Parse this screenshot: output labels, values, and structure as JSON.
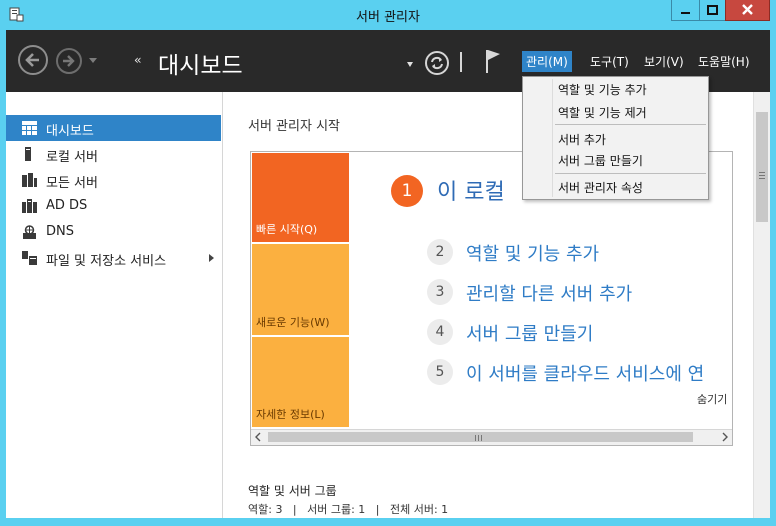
{
  "window": {
    "title": "서버 관리자",
    "close_color": "#c7483f",
    "accent_color": "#5ad0f0"
  },
  "toolbar": {
    "breadcrumb_arrows": "‹‹",
    "page_title": "대시보드",
    "icons": [
      "back-arrow-icon",
      "forward-arrow-icon",
      "refresh-icon",
      "flag-icon"
    ],
    "menus": [
      {
        "label": "관리(M)",
        "active": true
      },
      {
        "label": "도구(T)"
      },
      {
        "label": "보기(V)"
      },
      {
        "label": "도움말(H)"
      }
    ]
  },
  "manage_menu": {
    "items": [
      "역할 및 기능 추가",
      "역할 및 기능 제거",
      "서버 추가",
      "서버 그룹 만들기",
      "서버 관리자 속성"
    ]
  },
  "sidebar": {
    "items": [
      {
        "label": "대시보드",
        "icon": "dashboard-icon",
        "selected": true
      },
      {
        "label": "로컬 서버",
        "icon": "server-icon"
      },
      {
        "label": "모든 서버",
        "icon": "servers-icon"
      },
      {
        "label": "AD DS",
        "icon": "ad-ds-icon"
      },
      {
        "label": "DNS",
        "icon": "dns-icon"
      },
      {
        "label": "파일 및 저장소 서비스",
        "icon": "file-storage-icon",
        "has_submenu": true
      }
    ]
  },
  "main": {
    "section_title": "서버 관리자 시작",
    "tiles": [
      {
        "label": "빠른 시작(Q)",
        "color": "#f26522"
      },
      {
        "label": "새로운 기능(W)",
        "color": "#fbb040"
      },
      {
        "label": "자세한 정보(L)",
        "color": "#fbb040"
      }
    ],
    "big_step": {
      "number": "1",
      "label": "이 로컬"
    },
    "steps": [
      {
        "number": "2",
        "label": "역할 및 기능 추가"
      },
      {
        "number": "3",
        "label": "관리할 다른 서버 추가"
      },
      {
        "number": "4",
        "label": "서버 그룹 만들기"
      },
      {
        "number": "5",
        "label": "이 서버를 클라우드 서비스에 연"
      }
    ],
    "hide_link": "숨기기",
    "roles_title": "역할 및 서버 그룹",
    "roles_summary": "역할: 3   |   서버 그룹: 1   |   전체 서버: 1"
  }
}
